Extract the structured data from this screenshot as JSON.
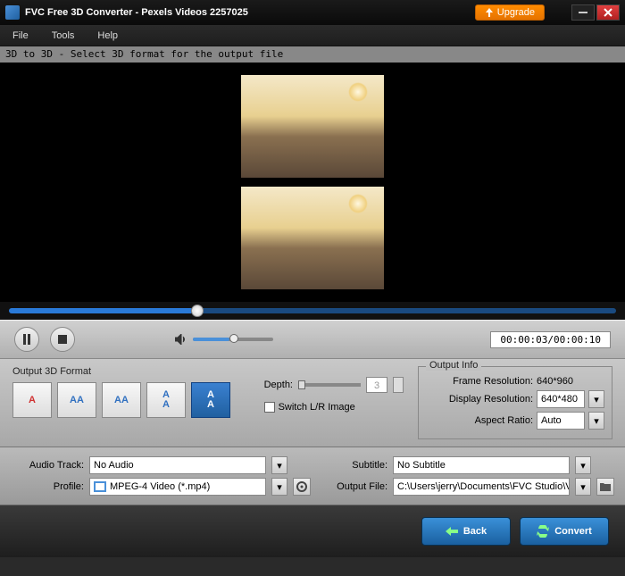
{
  "titlebar": {
    "title": "FVC Free 3D Converter - Pexels Videos 2257025",
    "upgrade": "Upgrade"
  },
  "menu": {
    "file": "File",
    "tools": "Tools",
    "help": "Help"
  },
  "hint": "3D to 3D - Select 3D format for the output file",
  "seek": {
    "percent": 30
  },
  "time": "00:00:03/00:00:10",
  "output3d": {
    "label": "Output 3D Format",
    "depth_label": "Depth:",
    "depth_value": "3",
    "switch_label": "Switch L/R Image"
  },
  "formats": [
    {
      "glyph": "A",
      "cls": "fmt-red"
    },
    {
      "glyph": "AA",
      "cls": "fmt-blue"
    },
    {
      "glyph": "AA",
      "cls": "fmt-blue"
    },
    {
      "glyph": "AA",
      "cls": "fmt-blue fmt-small"
    },
    {
      "glyph": "AA",
      "cls": "fmt-white fmt-small",
      "selected": true
    }
  ],
  "outputinfo": {
    "label": "Output Info",
    "frame_res_label": "Frame Resolution:",
    "frame_res": "640*960",
    "disp_res_label": "Display Resolution:",
    "disp_res": "640*480",
    "aspect_label": "Aspect Ratio:",
    "aspect": "Auto"
  },
  "settings": {
    "audio_label": "Audio Track:",
    "audio": "No Audio",
    "subtitle_label": "Subtitle:",
    "subtitle": "No Subtitle",
    "profile_label": "Profile:",
    "profile": "MPEG-4 Video (*.mp4)",
    "output_file_label": "Output File:",
    "output_file": "C:\\Users\\jerry\\Documents\\FVC Studio\\V"
  },
  "footer": {
    "back": "Back",
    "convert": "Convert"
  }
}
